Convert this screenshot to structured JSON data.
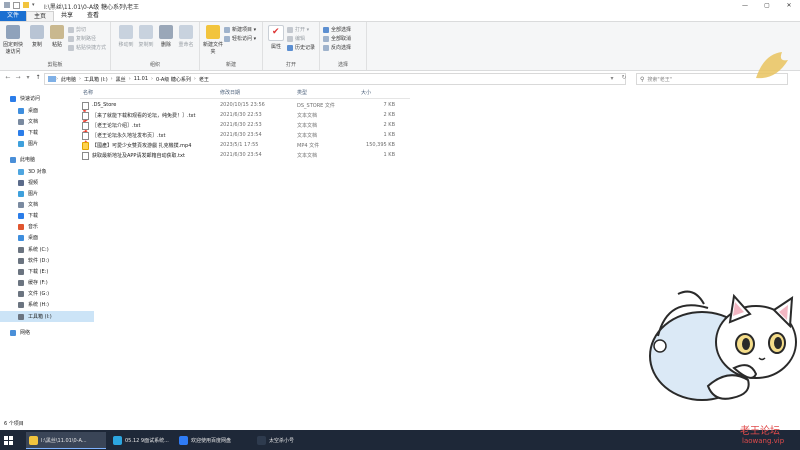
{
  "window": {
    "title": "I:\\黑丝\\11.01\\0-A级 糖心系列\\老王",
    "controls": [
      "—",
      "▢",
      "✕"
    ]
  },
  "ribbon": {
    "tabs": [
      "文件",
      "主页",
      "共享",
      "查看"
    ],
    "clipboard": {
      "pin_label": "固定到快速访问",
      "copy_label": "复制",
      "paste_label": "粘贴",
      "cut_label": "剪切",
      "copy_path_label": "复制路径",
      "paste_shortcut_label": "粘贴快捷方式",
      "group_label": "剪贴板"
    },
    "organize": {
      "move_label": "移动到",
      "copy_to_label": "复制到",
      "delete_label": "删除",
      "rename_label": "重命名",
      "group_label": "组织"
    },
    "new": {
      "new_folder_label": "新建文件夹",
      "new_item_label": "新建项目 ▾",
      "easy_access_label": "轻松访问 ▾",
      "group_label": "新建"
    },
    "open": {
      "properties_label": "属性",
      "open_label": "打开 ▾",
      "edit_label": "编辑",
      "history_label": "历史记录",
      "group_label": "打开"
    },
    "select": {
      "select_all_label": "全部选择",
      "select_none_label": "全部取消",
      "invert_label": "反向选择",
      "group_label": "选择"
    }
  },
  "address": {
    "crumbs": [
      "此电脑",
      "工具箱 (I:)",
      "黑丝",
      "11.01",
      "0-A级 糖心系列",
      "老王"
    ],
    "search_placeholder": "搜索\"老王\""
  },
  "navpane": {
    "items": [
      {
        "label": "快速访问",
        "color": "#2b7de9"
      },
      {
        "label": "桌面",
        "color": "#3e8ede",
        "pinned": true
      },
      {
        "label": "文档",
        "color": "#7a8aa0",
        "pinned": true
      },
      {
        "label": "下载",
        "color": "#2b7de9",
        "pinned": true
      },
      {
        "label": "图片",
        "color": "#3ea0dc",
        "pinned": true
      },
      {
        "label": "此电脑",
        "color": "#4a8fd8"
      },
      {
        "label": "3D 对象",
        "color": "#4fa6e0"
      },
      {
        "label": "视频",
        "color": "#5b6b8a"
      },
      {
        "label": "图片",
        "color": "#3ea0dc"
      },
      {
        "label": "文档",
        "color": "#7a8aa0"
      },
      {
        "label": "下载",
        "color": "#2b7de9"
      },
      {
        "label": "音乐",
        "color": "#e0552f"
      },
      {
        "label": "桌面",
        "color": "#3e8ede"
      },
      {
        "label": "系统 (C:)",
        "color": "#6b7480"
      },
      {
        "label": "软件 (D:)",
        "color": "#6b7480"
      },
      {
        "label": "下载 (E:)",
        "color": "#6b7480"
      },
      {
        "label": "缓存 (F:)",
        "color": "#6b7480"
      },
      {
        "label": "文件 (G:)",
        "color": "#6b7480"
      },
      {
        "label": "系统 (H:)",
        "color": "#6b7480"
      },
      {
        "label": "工具箱 (I:)",
        "color": "#6b7480",
        "selected": true
      },
      {
        "label": "网络",
        "color": "#4a8fd8"
      }
    ]
  },
  "filelist": {
    "headers": {
      "name": "名称",
      "date": "修改日期",
      "type": "类型",
      "size": "大小"
    },
    "rows": [
      {
        "name": ".DS_Store",
        "date": "2020/10/15 23:56",
        "type": "DS_STORE 文件",
        "size": "7 KB",
        "kind": "doc"
      },
      {
        "name": "［来了就能下载和观看的论坛，纯免费！］.txt",
        "date": "2021/6/30 22:53",
        "type": "文本文档",
        "size": "2 KB",
        "kind": "doc"
      },
      {
        "name": "［老王论坛介绍］.txt",
        "date": "2021/6/30 22:53",
        "type": "文本文档",
        "size": "2 KB",
        "kind": "doc"
      },
      {
        "name": "［老王论坛永久地址发布页］.txt",
        "date": "2021/6/30 23:54",
        "type": "文本文档",
        "size": "1 KB",
        "kind": "doc"
      },
      {
        "name": "【國產】可愛少女雙頁攻游戲 扎克機撲.mp4",
        "date": "2023/5/1 17:55",
        "type": "MP4 文件",
        "size": "150,395 KB",
        "kind": "vid"
      },
      {
        "name": "获取最新地址及APP请发邮箱自动获取.txt",
        "date": "2021/6/30 23:54",
        "type": "文本文档",
        "size": "1 KB",
        "kind": "doc"
      }
    ]
  },
  "status": {
    "count": "6 个项目"
  },
  "taskbar": {
    "items": [
      {
        "label": "I:\\黑丝\\11.01\\0-A...",
        "color": "#f2c43d",
        "active": true
      },
      {
        "label": "05.12 9面试系统...",
        "color": "#2ca6e0"
      },
      {
        "label": "欢迎使用百度网盘",
        "color": "#2f7cf6"
      },
      {
        "label": "太空杀小号",
        "color": "#2e3b4e"
      }
    ]
  },
  "watermark": {
    "title": "老王论坛",
    "url": "laowang.vip"
  },
  "colors": {
    "accent": "#1a6fd1",
    "taskbar": "#1e2838",
    "selection": "#cce4f7"
  }
}
